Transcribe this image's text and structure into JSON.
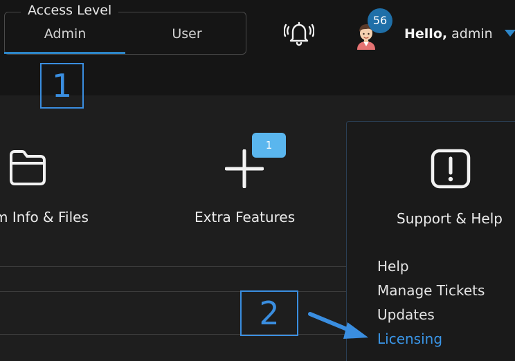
{
  "access_level": {
    "legend": "Access Level",
    "options": [
      "Admin",
      "User"
    ],
    "selected": "Admin"
  },
  "header": {
    "notification_count": "56",
    "greeting_bold": "Hello,",
    "greeting_name": "admin"
  },
  "steps": {
    "step1": "1",
    "step2": "2"
  },
  "tiles": {
    "files_label": "m Info & Files",
    "extra_label": "Extra Features",
    "extra_badge": "1",
    "support_label": "Support & Help"
  },
  "support_menu": {
    "items": [
      "Help",
      "Manage Tickets",
      "Updates",
      "Licensing"
    ],
    "active": "Licensing"
  },
  "colors": {
    "accent": "#2d86c8",
    "annotation": "#3a8ee0",
    "active_link": "#3a95e6",
    "badge": "#5ab6ee"
  },
  "icons": {
    "bell": "bell-icon",
    "folder": "folder-icon",
    "plus": "plus-icon",
    "alert": "alert-square-icon",
    "caret": "caret-down-icon",
    "arrow": "arrow-icon"
  }
}
